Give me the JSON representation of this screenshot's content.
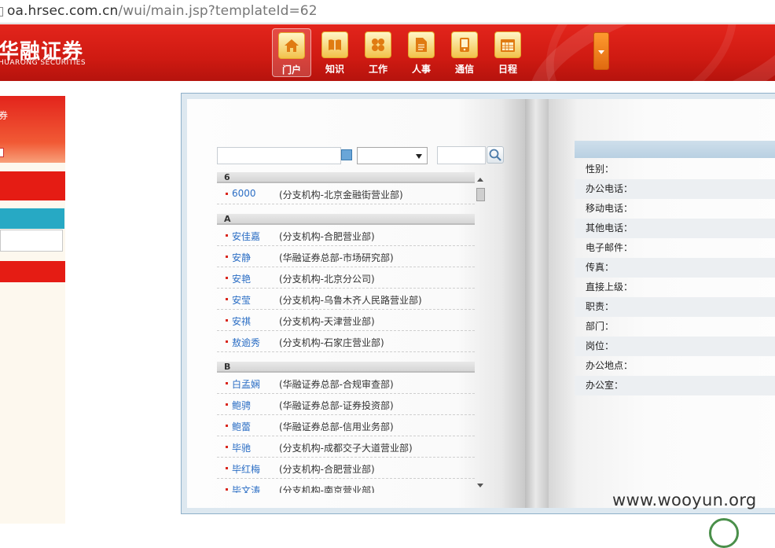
{
  "browser": {
    "url_host": "oa.hrsec.com.cn",
    "url_path": "/wui/main.jsp?templateId=62"
  },
  "header": {
    "logo_cn": "华融证券",
    "logo_en": "HUARONG SECURITIES",
    "nav": [
      {
        "label": "门户",
        "icon": "home-icon"
      },
      {
        "label": "知识",
        "icon": "book-icon"
      },
      {
        "label": "工作",
        "icon": "workflow-icon"
      },
      {
        "label": "人事",
        "icon": "document-icon"
      },
      {
        "label": "通信",
        "icon": "mobile-icon"
      },
      {
        "label": "日程",
        "icon": "calendar-icon"
      }
    ],
    "active_index": 0
  },
  "sidebar": {
    "top_text": "券"
  },
  "directory": {
    "search_value": "",
    "select_value": "",
    "groups": [
      {
        "letter": "6",
        "rows": [
          {
            "name": "6000",
            "dept": "(分支机构-北京金融街营业部)"
          }
        ]
      },
      {
        "letter": "A",
        "rows": [
          {
            "name": "安佳嘉",
            "dept": "(分支机构-合肥营业部)"
          },
          {
            "name": "安静",
            "dept": "(华融证券总部-市场研究部)"
          },
          {
            "name": "安艳",
            "dept": "(分支机构-北京分公司)"
          },
          {
            "name": "安莹",
            "dept": "(分支机构-乌鲁木齐人民路营业部)"
          },
          {
            "name": "安祺",
            "dept": "(分支机构-天津营业部)"
          },
          {
            "name": "敖逾秀",
            "dept": "(分支机构-石家庄营业部)"
          }
        ]
      },
      {
        "letter": "B",
        "rows": [
          {
            "name": "白孟娴",
            "dept": "(华融证券总部-合规审查部)"
          },
          {
            "name": "鲍骋",
            "dept": "(华融证券总部-证券投资部)"
          },
          {
            "name": "鲍蕾",
            "dept": "(华融证券总部-信用业务部)"
          },
          {
            "name": "毕驰",
            "dept": "(分支机构-成都交子大道营业部)"
          },
          {
            "name": "毕红梅",
            "dept": "(分支机构-合肥营业部)"
          },
          {
            "name": "毕文涛",
            "dept": "(分支机构-南京营业部)"
          }
        ]
      }
    ]
  },
  "detail": {
    "fields": [
      "性别：",
      "办公电话：",
      "移动电话：",
      "其他电话：",
      "电子邮件：",
      "传真：",
      "直接上级：",
      "职责：",
      "部门：",
      "岗位：",
      "办公地点：",
      "办公室："
    ]
  },
  "watermark": "www.wooyun.org"
}
